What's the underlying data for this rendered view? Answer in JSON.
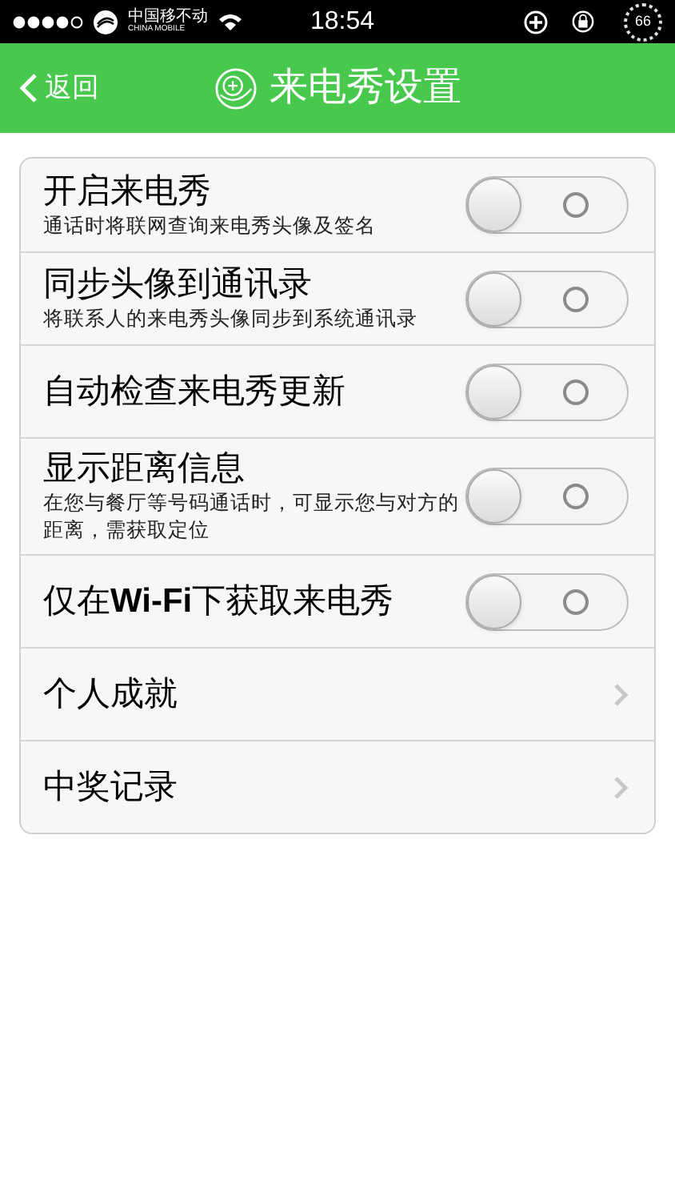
{
  "status_bar": {
    "carrier_cn": "中国移不动",
    "carrier_en": "CHINA MOBILE",
    "time": "18:54",
    "battery": "66"
  },
  "nav": {
    "back": "返回",
    "title": "来电秀设置"
  },
  "rows": [
    {
      "kind": "toggle",
      "title": "开启来电秀",
      "subtitle": "通话时将联网查询来电秀头像及签名",
      "on": false
    },
    {
      "kind": "toggle",
      "title": "同步头像到通讯录",
      "subtitle": "将联系人的来电秀头像同步到系统通讯录",
      "on": false
    },
    {
      "kind": "toggle",
      "title": "自动检查来电秀更新",
      "on": false
    },
    {
      "kind": "toggle",
      "title": "显示距离信息",
      "subtitle": "在您与餐厅等号码通话时，可显示您与对方的距离，需获取定位",
      "on": false
    },
    {
      "kind": "toggle",
      "title": "仅在**Wi-Fi**下获取来电秀",
      "on": false
    },
    {
      "kind": "link",
      "title": "个人成就"
    },
    {
      "kind": "link",
      "title": "中奖记录"
    }
  ]
}
